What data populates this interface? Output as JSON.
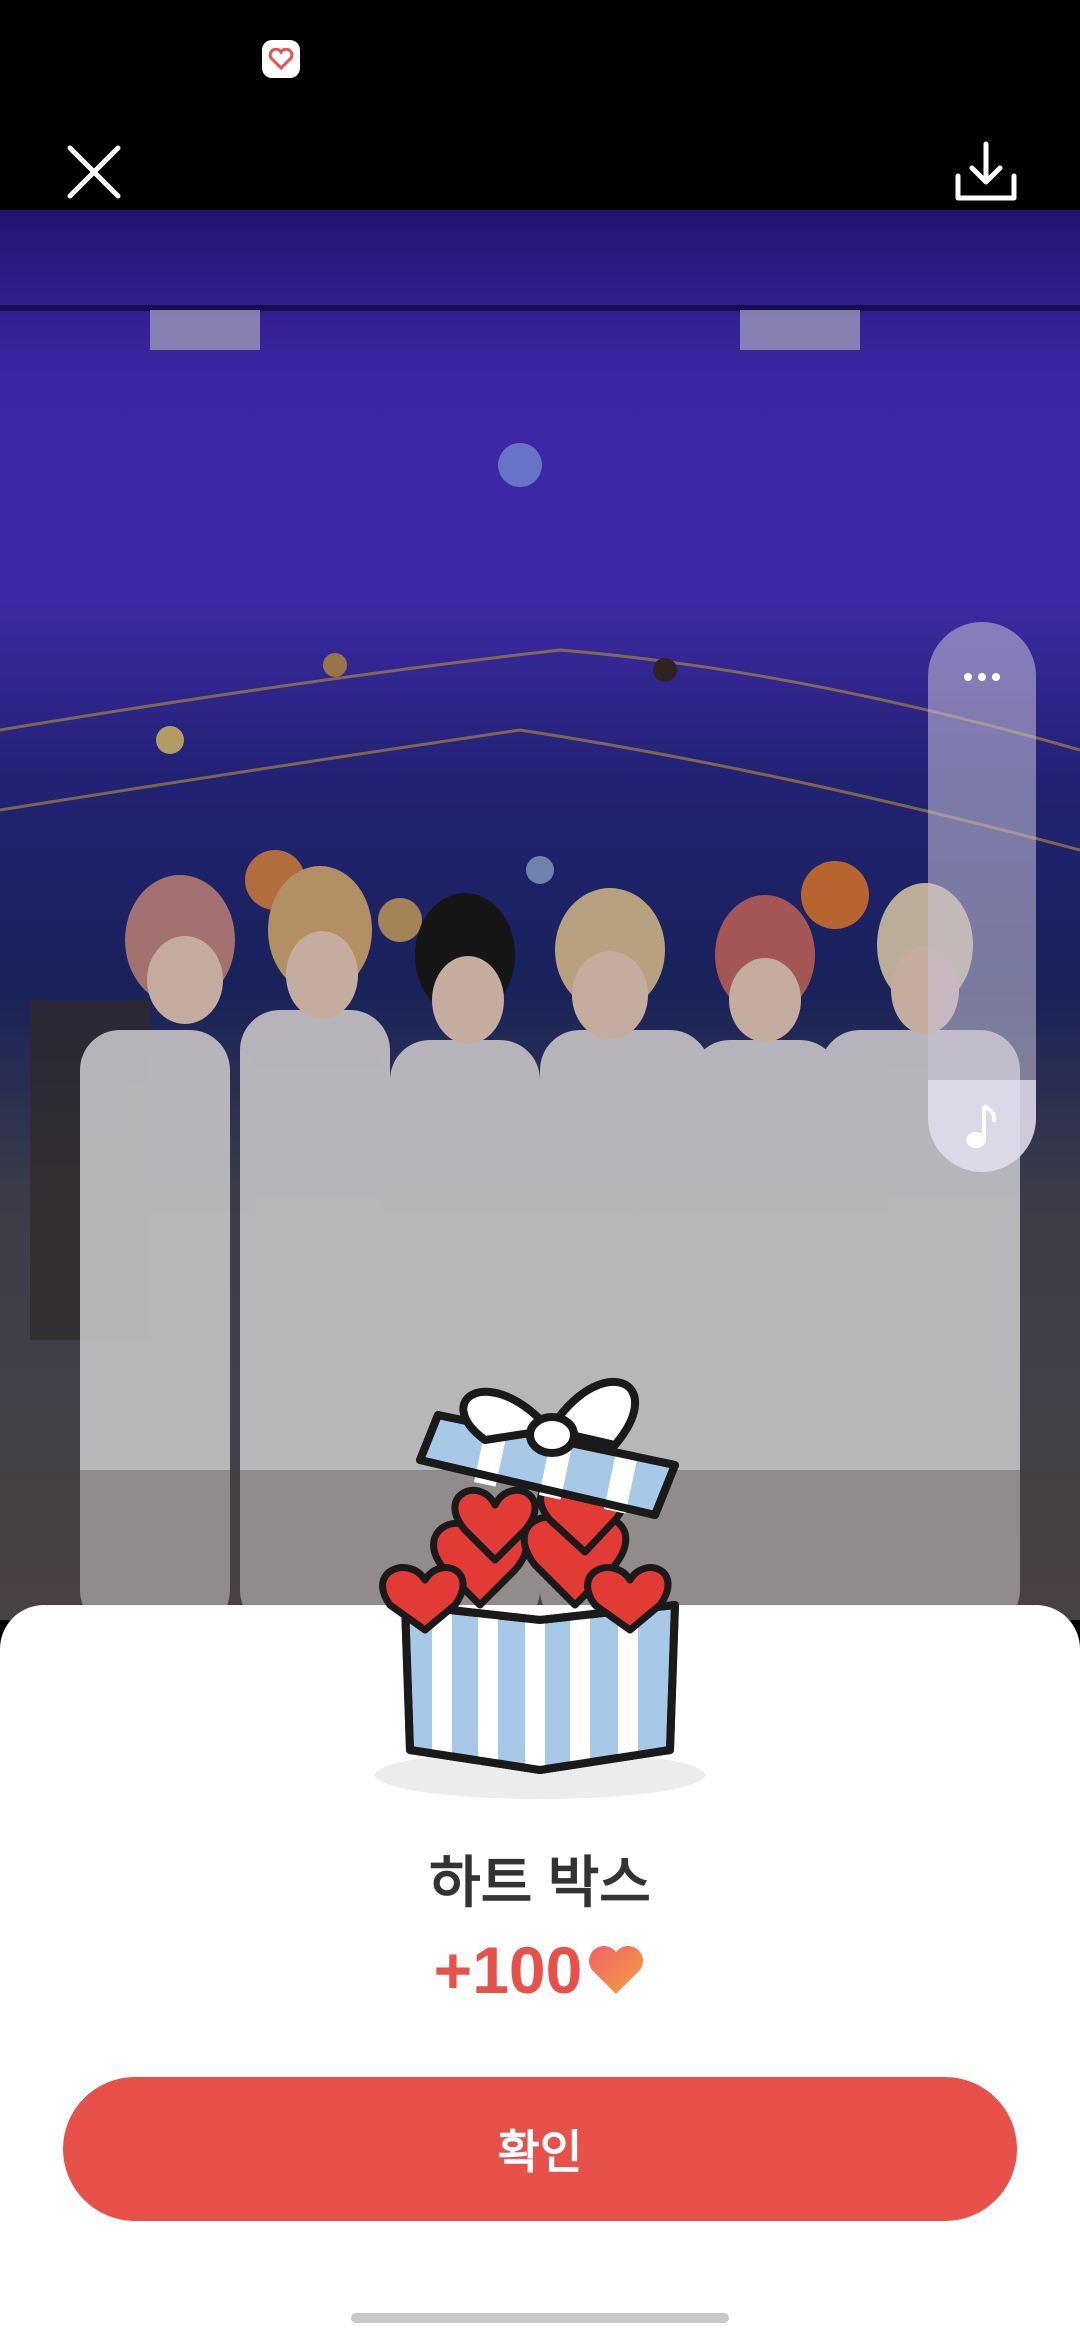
{
  "status_bar": {
    "app_icon": "heart-app-icon"
  },
  "top_bar": {
    "close_icon": "close-icon",
    "download_icon": "download-icon"
  },
  "photo": {
    "description_icon": "photo"
  },
  "side_panel": {
    "more_icon": "more-dots-icon",
    "music_icon": "music-note-icon"
  },
  "reward": {
    "title": "하트 박스",
    "amount": "+100",
    "heart_icon": "heart-icon"
  },
  "confirm_label": "확인",
  "colors": {
    "accent": "#e8504a",
    "title": "#333333"
  }
}
